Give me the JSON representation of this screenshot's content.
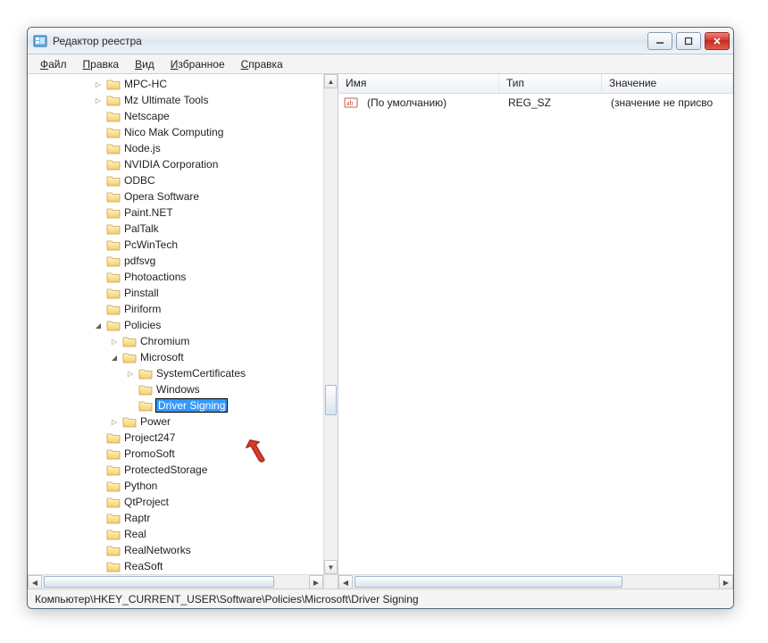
{
  "window": {
    "title": "Редактор реестра"
  },
  "menu": {
    "file": "Файл",
    "edit": "Правка",
    "view": "Вид",
    "favorites": "Избранное",
    "help": "Справка"
  },
  "tree": {
    "items": [
      {
        "indent": 4,
        "exp": "closed",
        "label": "MPC-HC"
      },
      {
        "indent": 4,
        "exp": "closed",
        "label": "Mz Ultimate Tools"
      },
      {
        "indent": 4,
        "exp": "none",
        "label": "Netscape"
      },
      {
        "indent": 4,
        "exp": "none",
        "label": "Nico Mak Computing"
      },
      {
        "indent": 4,
        "exp": "none",
        "label": "Node.js"
      },
      {
        "indent": 4,
        "exp": "none",
        "label": "NVIDIA Corporation"
      },
      {
        "indent": 4,
        "exp": "none",
        "label": "ODBC"
      },
      {
        "indent": 4,
        "exp": "none",
        "label": "Opera Software"
      },
      {
        "indent": 4,
        "exp": "none",
        "label": "Paint.NET"
      },
      {
        "indent": 4,
        "exp": "none",
        "label": "PalTalk"
      },
      {
        "indent": 4,
        "exp": "none",
        "label": "PcWinTech"
      },
      {
        "indent": 4,
        "exp": "none",
        "label": "pdfsvg"
      },
      {
        "indent": 4,
        "exp": "none",
        "label": "Photoactions"
      },
      {
        "indent": 4,
        "exp": "none",
        "label": "Pinstall"
      },
      {
        "indent": 4,
        "exp": "none",
        "label": "Piriform"
      },
      {
        "indent": 4,
        "exp": "open",
        "label": "Policies"
      },
      {
        "indent": 5,
        "exp": "closed",
        "label": "Chromium"
      },
      {
        "indent": 5,
        "exp": "open",
        "label": "Microsoft"
      },
      {
        "indent": 6,
        "exp": "closed",
        "label": "SystemCertificates"
      },
      {
        "indent": 6,
        "exp": "none",
        "label": "Windows"
      },
      {
        "indent": 6,
        "exp": "none",
        "label": "Driver Signing",
        "editing": true
      },
      {
        "indent": 5,
        "exp": "closed",
        "label": "Power"
      },
      {
        "indent": 4,
        "exp": "none",
        "label": "Project247"
      },
      {
        "indent": 4,
        "exp": "none",
        "label": "PromoSoft"
      },
      {
        "indent": 4,
        "exp": "none",
        "label": "ProtectedStorage"
      },
      {
        "indent": 4,
        "exp": "none",
        "label": "Python"
      },
      {
        "indent": 4,
        "exp": "none",
        "label": "QtProject"
      },
      {
        "indent": 4,
        "exp": "none",
        "label": "Raptr"
      },
      {
        "indent": 4,
        "exp": "none",
        "label": "Real"
      },
      {
        "indent": 4,
        "exp": "none",
        "label": "RealNetworks"
      },
      {
        "indent": 4,
        "exp": "none",
        "label": "ReaSoft"
      }
    ]
  },
  "list": {
    "columns": {
      "name": "Имя",
      "type": "Тип",
      "value": "Значение"
    },
    "col_widths": {
      "name": 180,
      "type": 115,
      "value": 160
    },
    "rows": [
      {
        "name": "(По умолчанию)",
        "type": "REG_SZ",
        "value": "(значение не присво"
      }
    ]
  },
  "status": {
    "path": "Компьютер\\HKEY_CURRENT_USER\\Software\\Policies\\Microsoft\\Driver Signing"
  }
}
